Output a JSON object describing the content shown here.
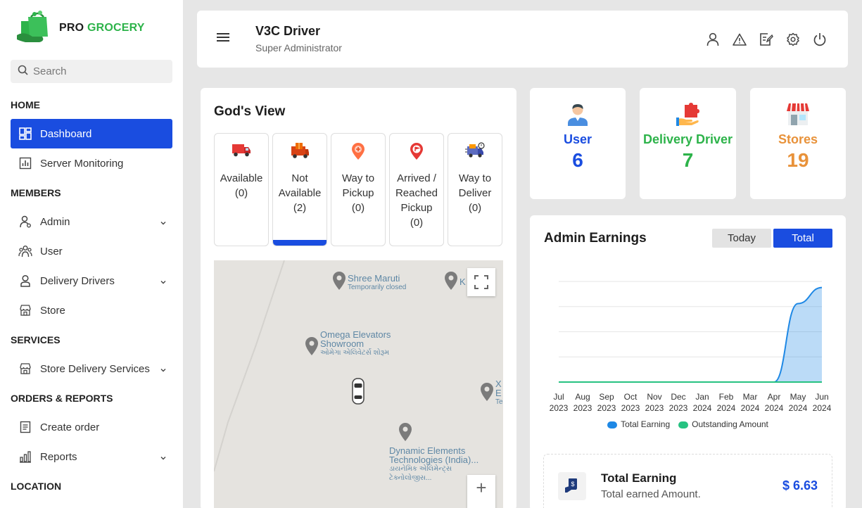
{
  "brand": {
    "part1": "PRO",
    "part2": "GROCERY"
  },
  "search": {
    "placeholder": "Search"
  },
  "sidebar": {
    "sections": [
      "HOME",
      "MEMBERS",
      "SERVICES",
      "ORDERS & REPORTS",
      "LOCATION"
    ],
    "items": [
      {
        "label": "Dashboard",
        "icon": "dashboard-icon"
      },
      {
        "label": "Server Monitoring",
        "icon": "chart-icon"
      },
      {
        "label": "Admin",
        "icon": "admin-icon"
      },
      {
        "label": "User",
        "icon": "users-icon"
      },
      {
        "label": "Delivery Drivers",
        "icon": "driver-icon"
      },
      {
        "label": "Store",
        "icon": "store-icon"
      },
      {
        "label": "Store Delivery Services",
        "icon": "store-icon"
      },
      {
        "label": "Create order",
        "icon": "order-icon"
      },
      {
        "label": "Reports",
        "icon": "bar-chart-icon"
      }
    ]
  },
  "header": {
    "title": "V3C Driver",
    "subtitle": "Super Administrator"
  },
  "gods_view": {
    "title": "God's View",
    "stats": [
      {
        "label": "Available",
        "count": "(0)"
      },
      {
        "label": "Not Available",
        "count": "(2)"
      },
      {
        "label": "Way to Pickup",
        "count": "(0)"
      },
      {
        "label": "Arrived / Reached Pickup",
        "count": "(0)"
      },
      {
        "label": "Way to Deliver",
        "count": "(0)"
      }
    ],
    "map_labels": [
      {
        "name": "Shree Maruti",
        "sub": "Temporarily closed"
      },
      {
        "name": "K",
        "sub": ""
      },
      {
        "name": "Omega Elevators Showroom",
        "sub": "ઓમેગા એલિવેટર્સ શોરૂમ"
      },
      {
        "name": "X E",
        "sub": "Te"
      },
      {
        "name": "Dynamic Elements Technologies (India)...",
        "sub": "ડાયનેમિક એલિમેન્ટ્સ ટેક્નોલોજીસ..."
      }
    ],
    "zoom_in_label": "+"
  },
  "cards": [
    {
      "title": "User",
      "value": "6",
      "color": "#1a4de0"
    },
    {
      "title": "Delivery Driver",
      "value": "7",
      "color": "#2db34a"
    },
    {
      "title": "Stores",
      "value": "19",
      "color": "#e8923a"
    }
  ],
  "earnings": {
    "title": "Admin Earnings",
    "toggle_today": "Today",
    "toggle_total": "Total",
    "total_label": "Total Earning",
    "total_sub": "Total earned Amount.",
    "total_value": "$ 6.63"
  },
  "chart_data": {
    "type": "area",
    "categories": [
      "Jul 2023",
      "Aug 2023",
      "Sep 2023",
      "Oct 2023",
      "Nov 2023",
      "Dec 2023",
      "Jan 2024",
      "Feb 2024",
      "Mar 2024",
      "Apr 2024",
      "May 2024",
      "Jun 2024"
    ],
    "x_ticks": [
      [
        "Jul",
        "2023"
      ],
      [
        "Aug",
        "2023"
      ],
      [
        "Sep",
        "2023"
      ],
      [
        "Oct",
        "2023"
      ],
      [
        "Nov",
        "2023"
      ],
      [
        "Dec",
        "2023"
      ],
      [
        "Jan",
        "2024"
      ],
      [
        "Feb",
        "2024"
      ],
      [
        "Mar",
        "2024"
      ],
      [
        "Apr",
        "2024"
      ],
      [
        "May",
        "2024"
      ],
      [
        "Jun",
        "2024"
      ]
    ],
    "series": [
      {
        "name": "Total Earning",
        "color": "#1e88e5",
        "values": [
          0,
          0,
          0,
          0,
          0,
          0,
          0,
          0,
          0,
          0,
          3.9,
          4.7
        ]
      },
      {
        "name": "Outstanding Amount",
        "color": "#26c281",
        "values": [
          0,
          0,
          0,
          0,
          0,
          0,
          0,
          0,
          0,
          0,
          0,
          0
        ]
      }
    ],
    "ylim": [
      0,
      5
    ],
    "grid": true,
    "legend": "bottom"
  }
}
